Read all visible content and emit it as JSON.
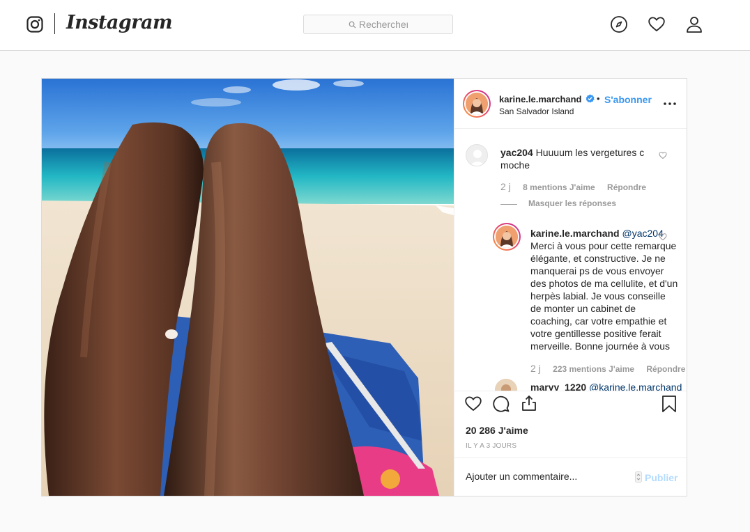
{
  "nav": {
    "brand": "Instagram",
    "search_placeholder": "Rechercher"
  },
  "post": {
    "username": "karine.le.marchand",
    "separator": "•",
    "follow_label": "S'abonner",
    "location": "San Salvador Island",
    "comments": [
      {
        "username": "yac204",
        "text": "Huuuum les vergetures c moche",
        "age": "2 j",
        "likes": "8 mentions J'aime",
        "reply": "Répondre",
        "toggle_replies": "Masquer les réponses"
      },
      {
        "username": "karine.le.marchand",
        "mention": "@yac204",
        "text": "Merci à vous pour cette remarque élégante, et constructive. Je ne manquerai ps de vous envoyer des photos de ma cellulite, et d'un herpès labial. Je vous conseille de monter un cabinet de coaching, car votre empathie et votre gentillesse positive ferait merveille. Bonne journée à vous",
        "age": "2 j",
        "likes": "223 mentions J'aime",
        "reply": "Répondre"
      },
      {
        "username": "maryy_1220",
        "mention": "@karine.le.marchand"
      }
    ],
    "likes_count": "20 286 J'aime",
    "timestamp": "IL Y A 3 JOURS",
    "comment_placeholder": "Ajouter un commentaire...",
    "publish_label": "Publier"
  },
  "colors": {
    "link_blue": "#3897f0",
    "publish_disabled": "#b3dbff",
    "border": "#dbdbdb",
    "muted": "#999999",
    "mention": "#003569"
  }
}
